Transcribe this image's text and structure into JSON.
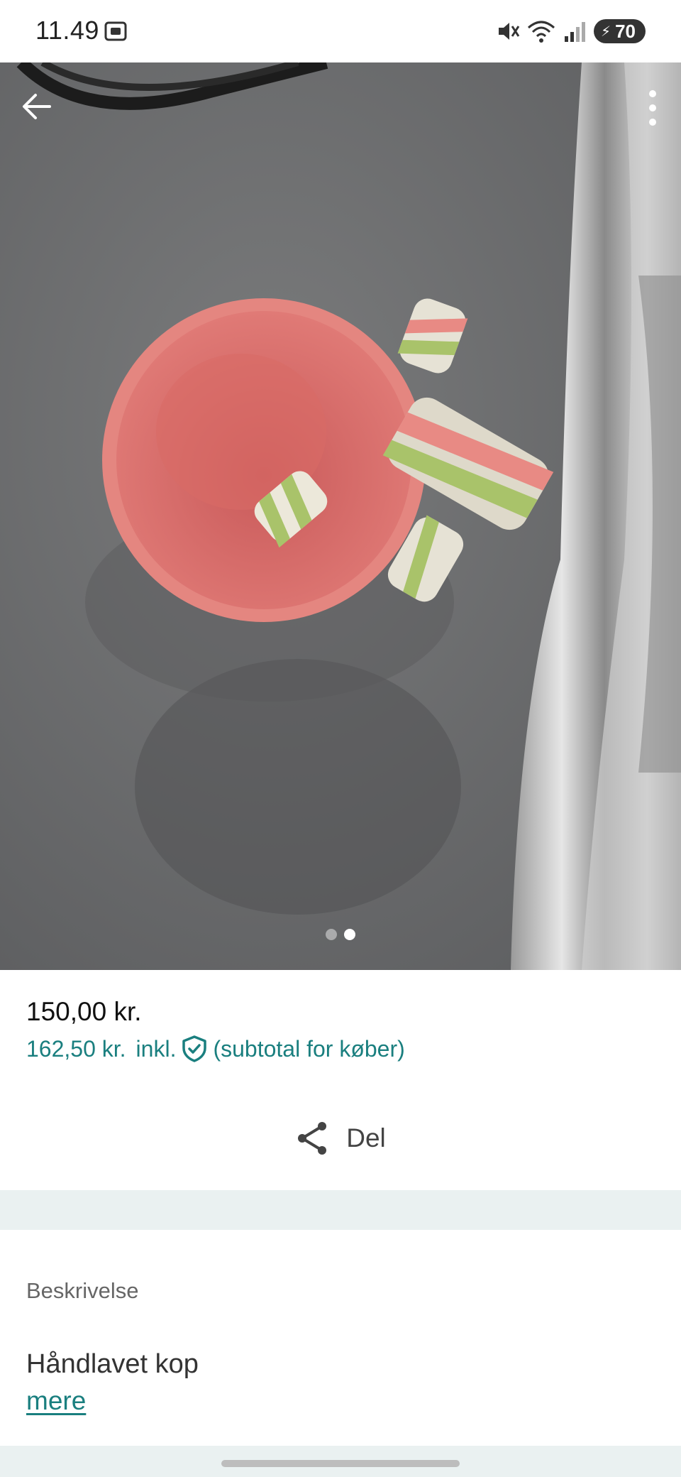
{
  "status_bar": {
    "time": "11.49",
    "battery": "70",
    "icons": [
      "screen-record-icon",
      "mute-icon",
      "wifi-icon",
      "signal-icon",
      "battery-icon"
    ]
  },
  "gallery": {
    "image_count": 2,
    "active_index": 1
  },
  "price": {
    "amount": "150,00 kr.",
    "incl_amount": "162,50 kr.",
    "incl_label": "inkl.",
    "subtotal_note": "(subtotal for køber)"
  },
  "share": {
    "label": "Del"
  },
  "description": {
    "heading": "Beskrivelse",
    "text": "Håndlavet kop",
    "more_link": "mere"
  },
  "colors": {
    "accent": "#1a7f7f",
    "band": "#eaf1f1"
  }
}
